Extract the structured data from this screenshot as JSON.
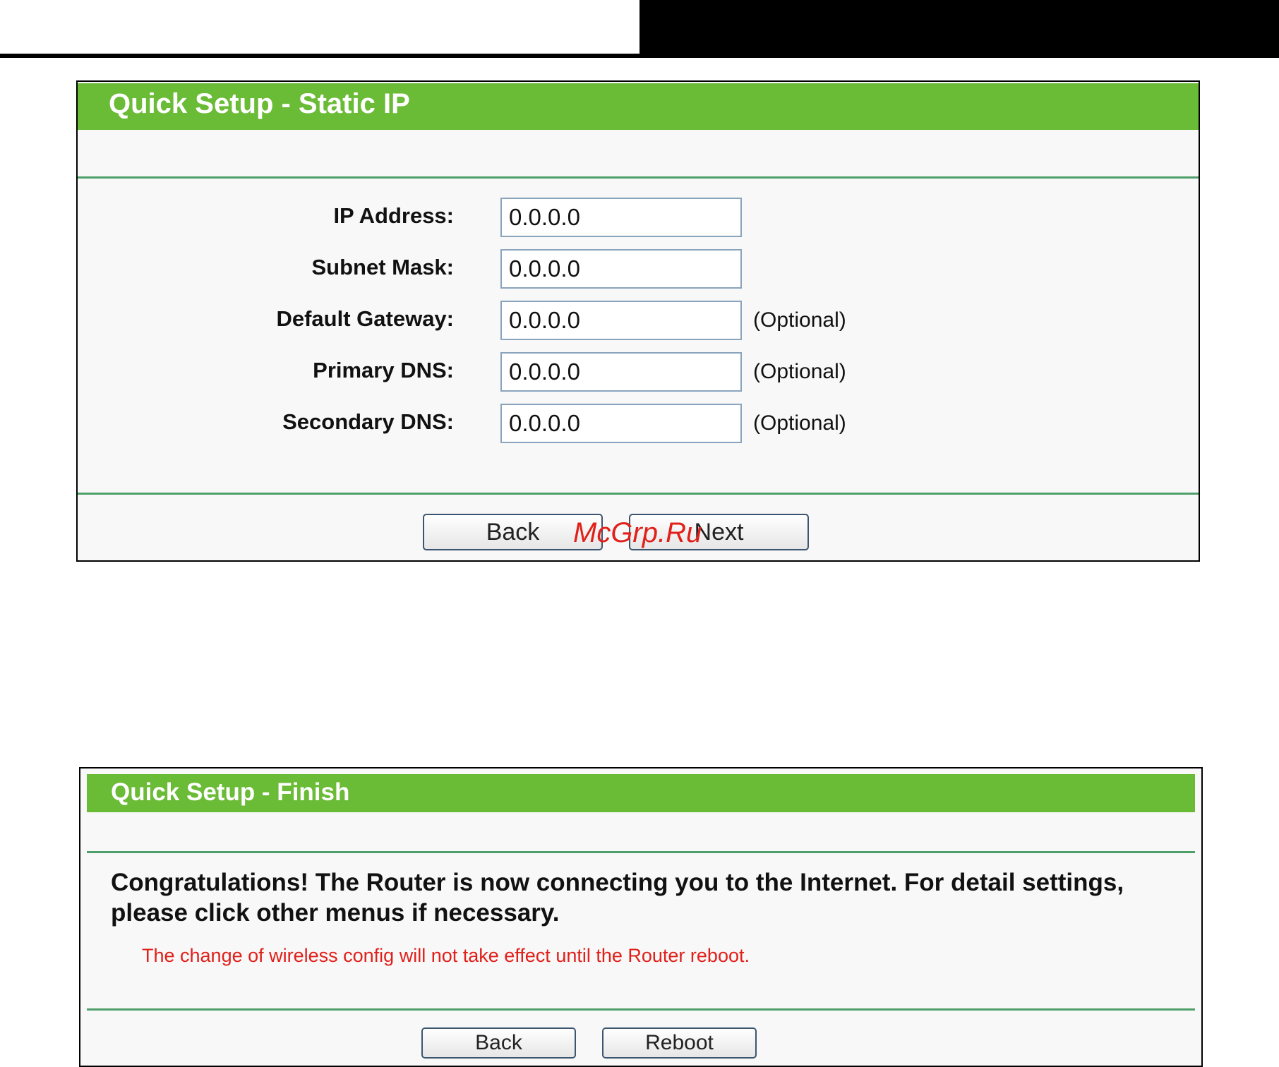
{
  "static_ip_panel": {
    "title": "Quick Setup - Static IP",
    "fields": [
      {
        "label": "IP Address:",
        "value": "0.0.0.0",
        "note": ""
      },
      {
        "label": "Subnet Mask:",
        "value": "0.0.0.0",
        "note": ""
      },
      {
        "label": "Default Gateway:",
        "value": "0.0.0.0",
        "note": "(Optional)"
      },
      {
        "label": "Primary DNS:",
        "value": "0.0.0.0",
        "note": "(Optional)"
      },
      {
        "label": "Secondary DNS:",
        "value": "0.0.0.0",
        "note": "(Optional)"
      }
    ],
    "back_label": "Back",
    "next_label": "Next"
  },
  "watermark": "McGrp.Ru",
  "finish_panel": {
    "title": "Quick Setup - Finish",
    "message": "Congratulations! The Router is now connecting you to the Internet. For detail settings, please click other menus if necessary.",
    "note": "The change of wireless config will not take effect until the Router reboot.",
    "back_label": "Back",
    "reboot_label": "Reboot"
  },
  "colors": {
    "header_green": "#6abb35",
    "divider_green": "#4e9f6a",
    "warning_red": "#e0201a"
  }
}
